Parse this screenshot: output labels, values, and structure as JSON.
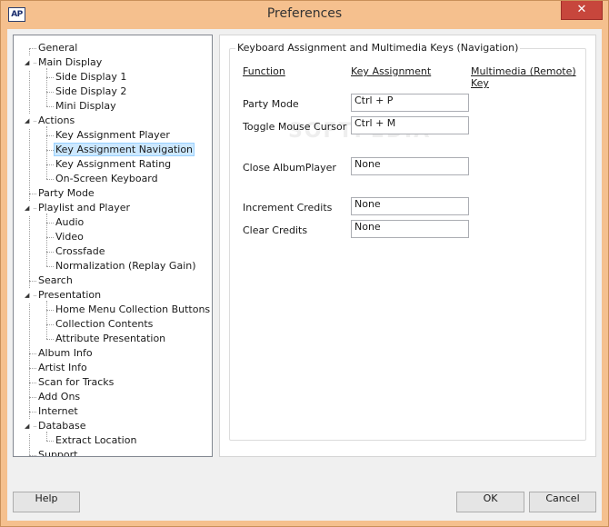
{
  "window": {
    "title": "Preferences",
    "app_icon_text": "AP",
    "close_glyph": "✕"
  },
  "tree": {
    "items": [
      {
        "label": "General",
        "level": 0,
        "expandable": false
      },
      {
        "label": "Main Display",
        "level": 0,
        "expandable": true
      },
      {
        "label": "Side Display 1",
        "level": 1,
        "expandable": false
      },
      {
        "label": "Side Display 2",
        "level": 1,
        "expandable": false
      },
      {
        "label": "Mini Display",
        "level": 1,
        "expandable": false
      },
      {
        "label": "Actions",
        "level": 0,
        "expandable": true
      },
      {
        "label": "Key Assignment Player",
        "level": 1,
        "expandable": false
      },
      {
        "label": "Key Assignment Navigation",
        "level": 1,
        "expandable": false,
        "selected": true
      },
      {
        "label": "Key Assignment Rating",
        "level": 1,
        "expandable": false
      },
      {
        "label": "On-Screen Keyboard",
        "level": 1,
        "expandable": false
      },
      {
        "label": "Party Mode",
        "level": 0,
        "expandable": false
      },
      {
        "label": "Playlist and Player",
        "level": 0,
        "expandable": true
      },
      {
        "label": "Audio",
        "level": 1,
        "expandable": false
      },
      {
        "label": "Video",
        "level": 1,
        "expandable": false
      },
      {
        "label": "Crossfade",
        "level": 1,
        "expandable": false
      },
      {
        "label": "Normalization (Replay Gain)",
        "level": 1,
        "expandable": false
      },
      {
        "label": "Search",
        "level": 0,
        "expandable": false
      },
      {
        "label": "Presentation",
        "level": 0,
        "expandable": true
      },
      {
        "label": "Home Menu Collection Buttons",
        "level": 1,
        "expandable": false
      },
      {
        "label": "Collection Contents",
        "level": 1,
        "expandable": false
      },
      {
        "label": "Attribute Presentation",
        "level": 1,
        "expandable": false
      },
      {
        "label": "Album Info",
        "level": 0,
        "expandable": false
      },
      {
        "label": "Artist Info",
        "level": 0,
        "expandable": false
      },
      {
        "label": "Scan for Tracks",
        "level": 0,
        "expandable": false
      },
      {
        "label": "Add Ons",
        "level": 0,
        "expandable": false
      },
      {
        "label": "Internet",
        "level": 0,
        "expandable": false
      },
      {
        "label": "Database",
        "level": 0,
        "expandable": true
      },
      {
        "label": "Extract Location",
        "level": 1,
        "expandable": false
      },
      {
        "label": "Support",
        "level": 0,
        "expandable": false
      }
    ]
  },
  "group": {
    "legend": "Keyboard Assignment and Multimedia Keys (Navigation)",
    "columns": {
      "function": "Function",
      "key_assignment": "Key Assignment",
      "multimedia": "Multimedia (Remote) Key"
    },
    "rows": [
      {
        "function": "Party Mode",
        "key": "Ctrl + P"
      },
      {
        "function": "Toggle Mouse Cursor",
        "key": "Ctrl + M"
      },
      {
        "function": "Close AlbumPlayer",
        "key": "None"
      },
      {
        "function": "Increment Credits",
        "key": "None"
      },
      {
        "function": "Clear Credits",
        "key": "None"
      }
    ]
  },
  "buttons": {
    "help": "Help",
    "ok": "OK",
    "cancel": "Cancel"
  },
  "watermark": "SOFTPEDIA"
}
